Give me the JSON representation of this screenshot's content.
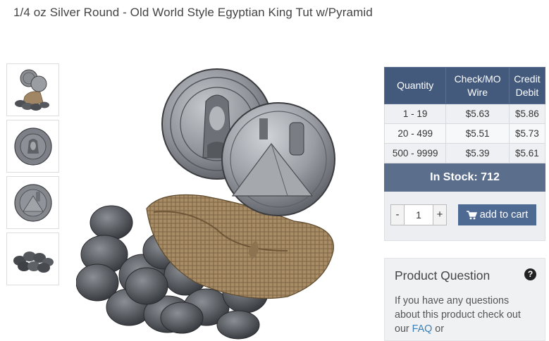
{
  "product": {
    "title": "1/4 oz Silver Round - Old World Style Egyptian King Tut w/Pyramid"
  },
  "thumbnails": [
    {
      "icon": "coins-with-bag-thumbnail"
    },
    {
      "icon": "king-tut-side-thumbnail"
    },
    {
      "icon": "pyramid-side-thumbnail"
    },
    {
      "icon": "coin-pile-thumbnail"
    }
  ],
  "pricing": {
    "headers": {
      "quantity": "Quantity",
      "check_line1": "Check/MO",
      "check_line2": "Wire",
      "credit_line1": "Credit",
      "credit_line2": "Debit"
    },
    "rows": [
      {
        "quantity": "1 - 19",
        "check": "$5.63",
        "credit": "$5.86"
      },
      {
        "quantity": "20 - 499",
        "check": "$5.51",
        "credit": "$5.73"
      },
      {
        "quantity": "500 - 9999",
        "check": "$5.39",
        "credit": "$5.61"
      }
    ]
  },
  "stock": {
    "label": "In Stock: 712"
  },
  "cart": {
    "minus": "-",
    "plus": "+",
    "quantity_value": "1",
    "add_label": "add to cart"
  },
  "question": {
    "title": "Product Question",
    "icon": "?",
    "text": "If you have any questions about this product check out our",
    "faq_link": "FAQ",
    "tail": "or"
  },
  "colors": {
    "header": "#435a7c",
    "stock_bar": "#5b6e8c",
    "button": "#4e6a93",
    "link": "#3b7fb8"
  }
}
